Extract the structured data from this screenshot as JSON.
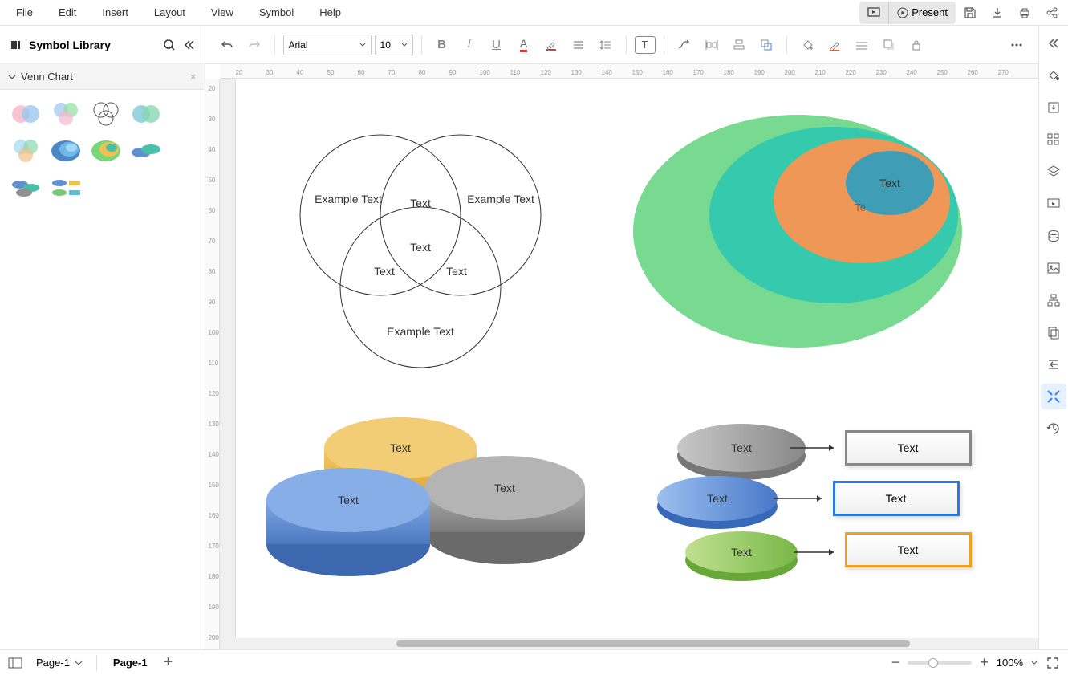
{
  "menu": {
    "file": "File",
    "edit": "Edit",
    "insert": "Insert",
    "layout": "Layout",
    "view": "View",
    "symbol": "Symbol",
    "help": "Help"
  },
  "top": {
    "present": "Present"
  },
  "library": {
    "title": "Symbol Library",
    "category": "Venn Chart"
  },
  "toolbar": {
    "font": "Arial",
    "size": "10"
  },
  "ruler_h": [
    "20",
    "30",
    "40",
    "50",
    "60",
    "70",
    "80",
    "90",
    "100",
    "110",
    "120",
    "130",
    "140",
    "150",
    "160",
    "170",
    "180",
    "190",
    "200",
    "210",
    "220",
    "230",
    "240",
    "250",
    "260",
    "270"
  ],
  "ruler_v": [
    "20",
    "30",
    "40",
    "50",
    "60",
    "70",
    "80",
    "90",
    "100",
    "110",
    "120",
    "130",
    "140",
    "150",
    "160",
    "170",
    "180",
    "190",
    "200"
  ],
  "canvas": {
    "venn3": {
      "a": "Example Text",
      "b": "Example Text",
      "c": "Example Text",
      "ab": "Text",
      "ac": "Text",
      "bc": "Text",
      "abc": "Text"
    },
    "stack": {
      "inner": "Text",
      "inner2": "Te"
    },
    "cyl3": {
      "a": "Text",
      "b": "Text",
      "c": "Text"
    },
    "list": {
      "d1": "Text",
      "d2": "Text",
      "d3": "Text",
      "l1": "Text",
      "l2": "Text",
      "l3": "Text"
    }
  },
  "status": {
    "page_sel": "Page-1",
    "tab": "Page-1",
    "zoom": "100%"
  }
}
